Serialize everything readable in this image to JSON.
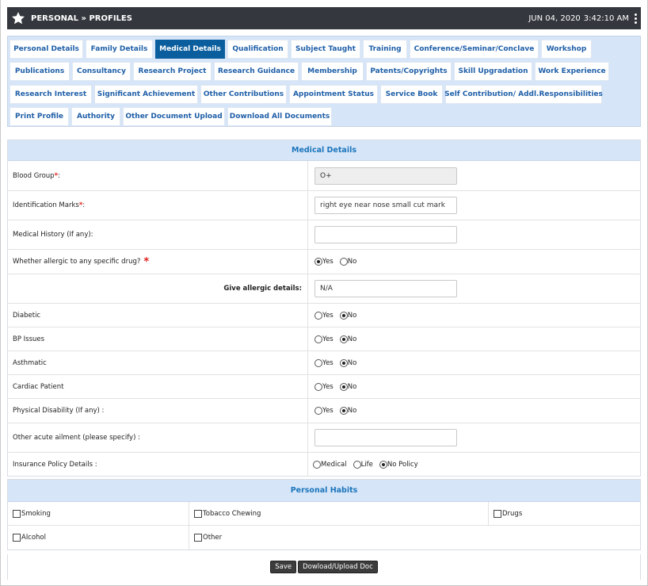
{
  "header": {
    "title": "PERSONAL » PROFILES",
    "date": "JUN 04, 2020",
    "time": "3:42:10 AM"
  },
  "tabs": [
    [
      "Personal Details",
      "Family Details",
      "Medical Details",
      "Qualification",
      "Subject Taught",
      "Training",
      "Conference/Seminar/Conclave",
      "Workshop"
    ],
    [
      "Publications",
      "Consultancy",
      "Research Project",
      "Research Guidance",
      "Membership",
      "Patents/Copyrights",
      "Skill Upgradation",
      "Work Experience"
    ],
    [
      "Research Interest",
      "Significant Achievement",
      "Other Contributions",
      "Appointment Status",
      "Service Book",
      "Self Contribution/ Addl.Responsibilities"
    ],
    [
      "Print Profile",
      "Authority",
      "Other Document Upload",
      "Download All Documents"
    ]
  ],
  "active_tab": "Medical Details",
  "medical": {
    "heading": "Medical Details",
    "blood_group_label": "Blood Group",
    "blood_group_value": "O+",
    "id_marks_label": "Identification Marks",
    "id_marks_value": "right eye near nose small cut mark",
    "history_label": "Medical History (If any):",
    "history_value": "",
    "allergic_label": "Whether allergic to any specific drug?",
    "allergic_details_label": "Give allergic details:",
    "allergic_details_value": "N/A",
    "diabetic_label": "Diabetic",
    "bp_label": "BP Issues",
    "asthmatic_label": "Asthmatic",
    "cardiac_label": "Cardiac Patient",
    "disability_label": "Physical Disability (If any) :",
    "acute_label": "Other acute ailment (please specify) :",
    "acute_value": "",
    "insurance_label": "Insurance Policy Details  :",
    "colon": " :",
    "req_mark": "*",
    "yes": "Yes",
    "no": "No",
    "ins_medical": "Medical",
    "ins_life": "Life",
    "ins_none": "No Policy"
  },
  "habits": {
    "heading": "Personal Habits",
    "smoking": "Smoking",
    "tobacco": "Tobacco Chewing",
    "drugs": "Drugs",
    "alcohol": "Alcohol",
    "other": "Other"
  },
  "actions": {
    "save": "Save",
    "upload": "Dowload/Upload Doc"
  }
}
